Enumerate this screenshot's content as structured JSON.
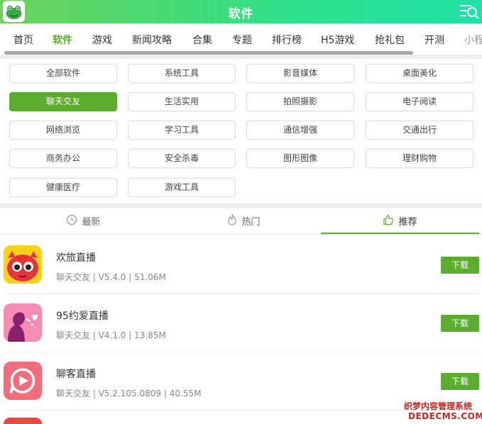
{
  "header": {
    "title": "软件"
  },
  "nav": {
    "items": [
      "首页",
      "软件",
      "游戏",
      "新闻攻略",
      "合集",
      "专题",
      "排行榜",
      "H5游戏",
      "抢礼包",
      "开测",
      "小程"
    ],
    "active": "软件"
  },
  "categories": [
    "全部软件",
    "系统工具",
    "影音媒体",
    "桌面美化",
    "聊天交友",
    "生活实用",
    "拍照摄影",
    "电子阅读",
    "网络浏览",
    "学习工具",
    "通信增强",
    "交通出行",
    "商务办公",
    "安全杀毒",
    "图形图像",
    "理财购物",
    "健康医疗",
    "游戏工具"
  ],
  "active_category": "聊天交友",
  "tabs": [
    {
      "label": "最新",
      "icon": "clock-icon"
    },
    {
      "label": "热门",
      "icon": "flame-icon"
    },
    {
      "label": "推荐",
      "icon": "thumbs-up-icon"
    }
  ],
  "active_tab": "推荐",
  "apps": [
    {
      "name": "欢旅直播",
      "meta": "聊天交友 | V5.4.0 | 51.06M",
      "button": "下载",
      "icon": "red-monster-icon"
    },
    {
      "name": "95约爱直播",
      "meta": "聊天交友 | V4.1.0 | 13.85M",
      "button": "下载",
      "icon": "girl-heart-icon"
    },
    {
      "name": "聊客直播",
      "meta": "聊天交友 | V5.2.105.0809 | 40.55M",
      "button": "下载",
      "icon": "play-chat-icon"
    }
  ],
  "watermark": {
    "line1": "织梦内容管理系统",
    "line2": "DEDECMS.COM"
  },
  "colors": {
    "accent": "#5cad2d",
    "header_start": "#6dd35a",
    "header_end": "#1fe0a8"
  }
}
